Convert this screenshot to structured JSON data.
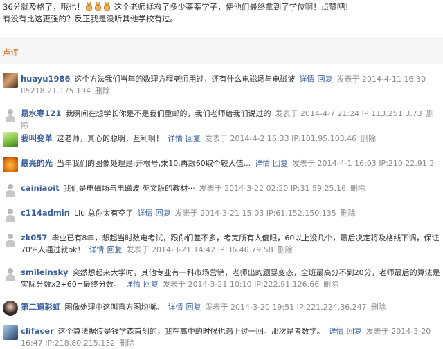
{
  "intro": {
    "line1_a": "36分就及格了，哦也！",
    "line1_b": "这个老师拯救了多少莘莘学子，使他们最终拿到了学位啊！点赞吧！",
    "line2": "有没有比这更强的？反正我是没听其他学校有过。"
  },
  "section": {
    "title": "点评"
  },
  "labels": {
    "detail": "详情",
    "reply": "回复",
    "delete": "删除"
  },
  "comments": [
    {
      "user": "huayu1986",
      "text": "这个方法我们当年的数理方程老师用过，还有什么电磁场与电磁波",
      "posted": "发表于 2014-4-11 16:30",
      "ip": "IP:218.21.175.194"
    },
    {
      "user": "易水寒121",
      "text": "我瞬间在想学长你是不是我们重邮的，我们老师给我们说过的",
      "posted": "发表于 2014-4-7 21:24",
      "ip": "IP:113.251.3.73"
    },
    {
      "user": "我叫变革",
      "text": "这老师，真心的聪明，互利啊！",
      "posted": "发表于 2014-4-2 16:33",
      "ip": "IP:101.95.103.46"
    },
    {
      "user": "最亮的光",
      "text": "当年我们的图像处理是:开根号,乘10,再跟60取个较大值...",
      "posted": "发表于 2014-4-1 16:03",
      "ip": "IP:210.22.91.2"
    },
    {
      "user": "cainiaoit",
      "text": "我们是电磁场与电磁波 英文版的教材···",
      "posted": "发表于 2014-3-22 02:20",
      "ip": "IP:31.59.25.16"
    },
    {
      "user": "c114admin",
      "text": "Liu 总你太有空了",
      "posted": "发表于 2014-3-21 15:03",
      "ip": "IP:61.152.150.135"
    },
    {
      "user": "zk057",
      "text": "毕业已有8年，想起当时数电考试，跟你们差不多，考完所有人傻眼，60以上没几个，最后决定将及格线下调，保证70%人通过就ok！",
      "posted": "发表于 2014-3-21 14:42",
      "ip": "IP:36.40.79.58"
    },
    {
      "user": "smileinsky",
      "text": "突然想起来大学时，其他专业有一科市场营销，老师出的题暴变态，全班最高分不到20分，老师最后的算法是实际分数x2+60=最终分数。",
      "posted": "发表于 2014-3-21 10:10",
      "ip": "IP:222.91.126.66"
    },
    {
      "user": "第二道彩虹",
      "text": "图像处理中这叫直方图均衡。",
      "posted": "发表于 2014-3-20 19:51",
      "ip": "IP:221.224.36.247"
    },
    {
      "user": "clifacer",
      "text": "这个算法据传是钱学森首创的，我在高中的时候也遇上过一回。那次是考数学。",
      "posted": "发表于 2014-3-20 16:47",
      "ip": "IP:218.80.215.132"
    }
  ]
}
